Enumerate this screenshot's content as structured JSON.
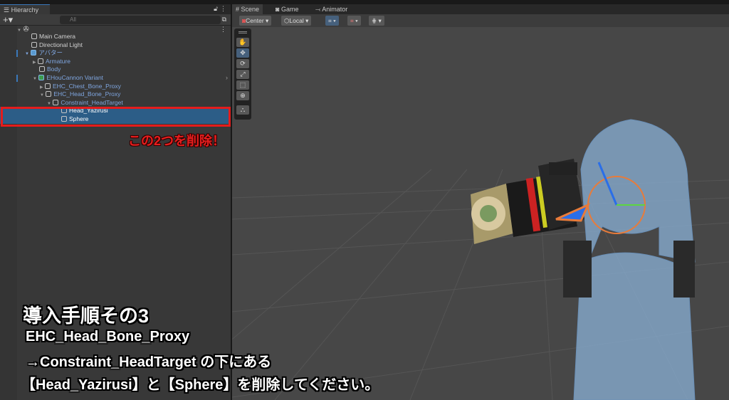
{
  "hierarchy": {
    "tab": "Hierarchy",
    "search_placeholder": "All",
    "items": [
      {
        "label": "Main Camera"
      },
      {
        "label": "Directional Light"
      },
      {
        "label": "アバター"
      },
      {
        "label": "Armature"
      },
      {
        "label": "Body"
      },
      {
        "label": "EHouCannon Variant"
      },
      {
        "label": "EHC_Chest_Bone_Proxy"
      },
      {
        "label": "EHC_Head_Bone_Proxy"
      },
      {
        "label": "Constraint_HeadTarget"
      },
      {
        "label": "Head_Yazirusi"
      },
      {
        "label": "Sphere"
      }
    ]
  },
  "scene": {
    "tabs": [
      "Scene",
      "Game",
      "Animator"
    ],
    "pivot": "Center",
    "space": "Local"
  },
  "annotation": "この2つを削除！",
  "caption": {
    "title": "導入手順その3",
    "line1": "EHC_Head_Bone_Proxy",
    "line2": "→Constraint_HeadTarget の下にある",
    "line3": "【Head_Yazirusi】と【Sphere】を削除してください。"
  }
}
